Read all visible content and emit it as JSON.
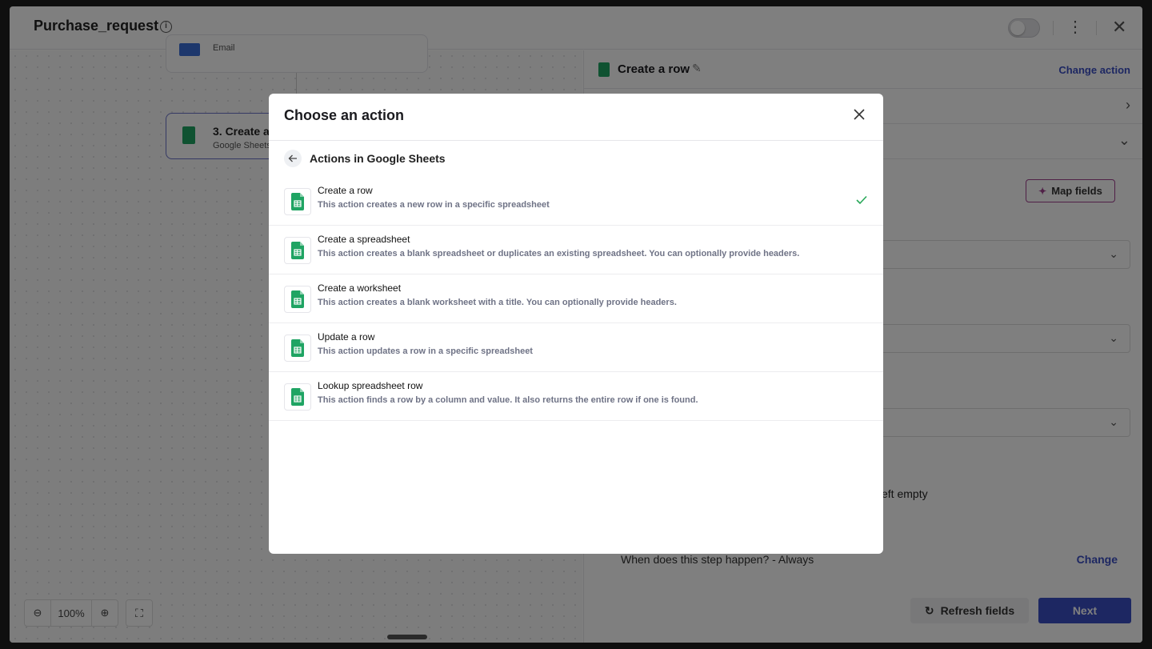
{
  "workflow": {
    "title": "Purchase_request"
  },
  "canvas": {
    "node1": {
      "subtitle": "Email"
    },
    "node3": {
      "title": "3. Create a",
      "subtitle": "Google Sheets"
    },
    "zoom": {
      "value": "100%"
    }
  },
  "panel": {
    "title": "Create a row",
    "change_action": "Change action",
    "map_fields": "Map fields",
    "partial_text": "eft empty",
    "condition_text": "When does this step happen? - Always",
    "change": "Change",
    "refresh_fields": "Refresh fields",
    "next": "Next"
  },
  "modal": {
    "title": "Choose an action",
    "subheading": "Actions in Google Sheets",
    "actions": [
      {
        "name": "Create a row",
        "description": "This action creates a new row in a specific spreadsheet",
        "selected": true
      },
      {
        "name": "Create a spreadsheet",
        "description": "This action creates a blank spreadsheet or duplicates an existing spreadsheet. You can optionally provide headers.",
        "selected": false
      },
      {
        "name": "Create a worksheet",
        "description": "This action creates a blank worksheet with a title. You can optionally provide headers.",
        "selected": false
      },
      {
        "name": "Update a row",
        "description": "This action updates a row in a specific spreadsheet",
        "selected": false
      },
      {
        "name": "Lookup spreadsheet row",
        "description": "This action finds a row by a column and value. It also returns the entire row if one is found.",
        "selected": false
      }
    ]
  },
  "colors": {
    "accent": "#3b4fc4",
    "sheets_green": "#1fa463",
    "check_green": "#2aa85a",
    "map_fields_border": "#a0408f"
  }
}
